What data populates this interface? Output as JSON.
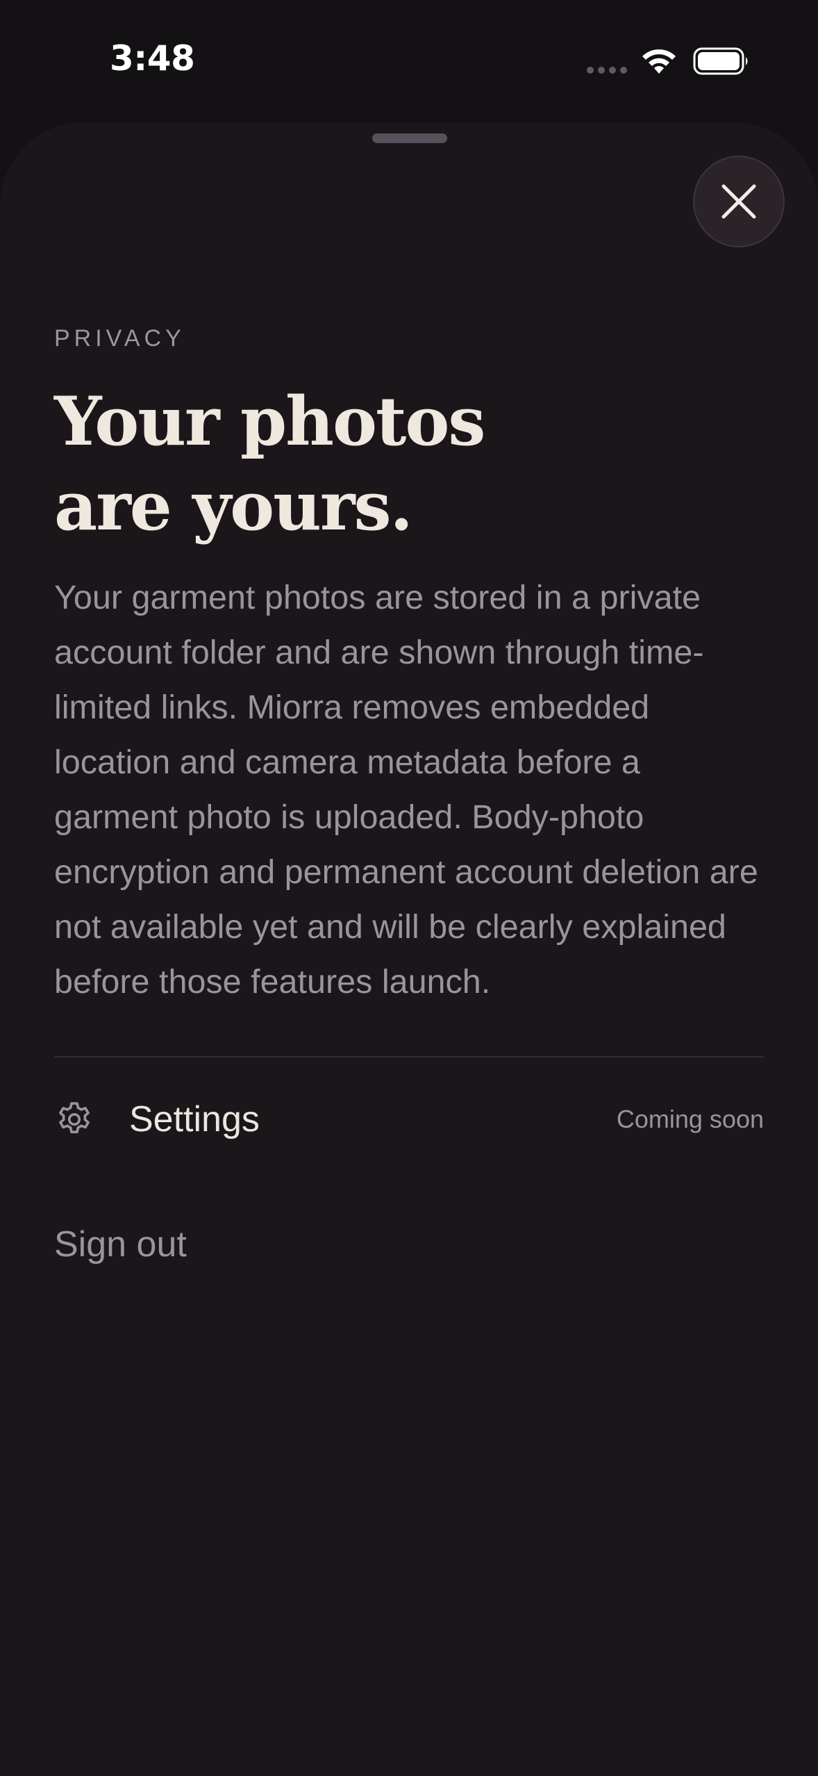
{
  "status_bar": {
    "time": "3:48",
    "icons": [
      "signal-dots-icon",
      "wifi-icon",
      "battery-icon"
    ]
  },
  "sheet": {
    "close_icon": "close-icon",
    "eyebrow": "PRIVACY",
    "headline": [
      "Your photos",
      "are yours."
    ],
    "body": "Your garment photos are stored in a private account folder and are shown through time-limited links. Miorra removes embedded location and camera metadata before a garment photo is uploaded. Body-photo encryption and permanent account deletion are not available yet and will be clearly explained before those features launch.",
    "settings": {
      "icon": "gear-icon",
      "label": "Settings",
      "badge": "Coming soon"
    },
    "sign_out": "Sign out"
  },
  "colors": {
    "background": "#141114",
    "sheet": "#1a161a",
    "headline": "#eee8df",
    "muted_text": "#9b9499"
  }
}
